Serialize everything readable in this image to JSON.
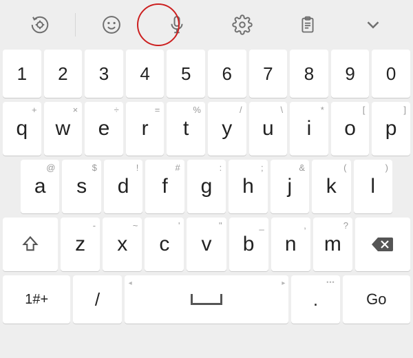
{
  "toolbar": {
    "icons": [
      "smart-typing",
      "emoji",
      "voice",
      "settings",
      "clipboard",
      "collapse"
    ],
    "highlighted": "voice"
  },
  "rows": {
    "numbers": [
      "1",
      "2",
      "3",
      "4",
      "5",
      "6",
      "7",
      "8",
      "9",
      "0"
    ],
    "r2": [
      {
        "m": "q",
        "h": "+"
      },
      {
        "m": "w",
        "h": "×"
      },
      {
        "m": "e",
        "h": "÷"
      },
      {
        "m": "r",
        "h": "="
      },
      {
        "m": "t",
        "h": "%"
      },
      {
        "m": "y",
        "h": "/"
      },
      {
        "m": "u",
        "h": "\\"
      },
      {
        "m": "i",
        "h": "*"
      },
      {
        "m": "o",
        "h": "["
      },
      {
        "m": "p",
        "h": "]"
      }
    ],
    "r3": [
      {
        "m": "a",
        "h": "@"
      },
      {
        "m": "s",
        "h": "$"
      },
      {
        "m": "d",
        "h": "!"
      },
      {
        "m": "f",
        "h": "#"
      },
      {
        "m": "g",
        "h": ":"
      },
      {
        "m": "h",
        "h": ";"
      },
      {
        "m": "j",
        "h": "&"
      },
      {
        "m": "k",
        "h": "("
      },
      {
        "m": "l",
        "h": ")"
      }
    ],
    "r4": [
      {
        "m": "z",
        "h": "-"
      },
      {
        "m": "x",
        "h": "~"
      },
      {
        "m": "c",
        "h": "'"
      },
      {
        "m": "v",
        "h": "\""
      },
      {
        "m": "b",
        "h": "_"
      },
      {
        "m": "n",
        "h": ","
      },
      {
        "m": "m",
        "h": "?"
      }
    ]
  },
  "bottom": {
    "symKey": "1#+",
    "slash": "/",
    "dot": ".",
    "go": "Go"
  }
}
